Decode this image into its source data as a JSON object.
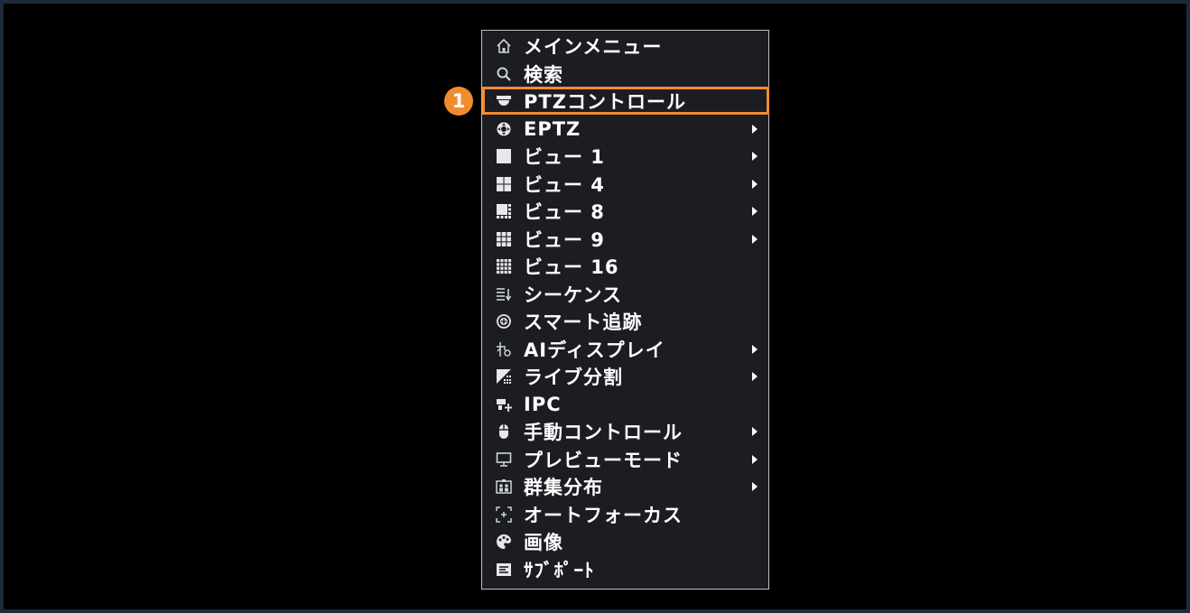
{
  "callout": {
    "number": "1",
    "color": "#f08c2e"
  },
  "menu": {
    "items": [
      {
        "label": "メインメニュー",
        "icon": "home-icon",
        "submenu": false
      },
      {
        "label": "検索",
        "icon": "search-icon",
        "submenu": false
      },
      {
        "label": "PTZコントロール",
        "icon": "ptz-dome-icon",
        "submenu": false,
        "highlighted": true
      },
      {
        "label": "EPTZ",
        "icon": "eptz-icon",
        "submenu": true
      },
      {
        "label": "ビュー 1",
        "icon": "view-1-icon",
        "submenu": true
      },
      {
        "label": "ビュー 4",
        "icon": "view-4-icon",
        "submenu": true
      },
      {
        "label": "ビュー 8",
        "icon": "view-8-icon",
        "submenu": true
      },
      {
        "label": "ビュー 9",
        "icon": "view-9-icon",
        "submenu": true
      },
      {
        "label": "ビュー 16",
        "icon": "view-16-icon",
        "submenu": false
      },
      {
        "label": "シーケンス",
        "icon": "sequence-icon",
        "submenu": false
      },
      {
        "label": "スマート追跡",
        "icon": "smart-tracking-icon",
        "submenu": false
      },
      {
        "label": "AIディスプレイ",
        "icon": "ai-display-icon",
        "submenu": true
      },
      {
        "label": "ライブ分割",
        "icon": "live-split-icon",
        "submenu": true
      },
      {
        "label": "IPC",
        "icon": "ipc-icon",
        "submenu": false
      },
      {
        "label": "手動コントロール",
        "icon": "mouse-icon",
        "submenu": true
      },
      {
        "label": "プレビューモード",
        "icon": "monitor-icon",
        "submenu": true
      },
      {
        "label": "群集分布",
        "icon": "crowd-distribution-icon",
        "submenu": true
      },
      {
        "label": "オートフォーカス",
        "icon": "autofocus-icon",
        "submenu": false
      },
      {
        "label": "画像",
        "icon": "image-palette-icon",
        "submenu": false
      },
      {
        "label": "ｻﾌﾞﾎﾟｰﾄ",
        "icon": "sub-port-icon",
        "submenu": false
      }
    ]
  }
}
